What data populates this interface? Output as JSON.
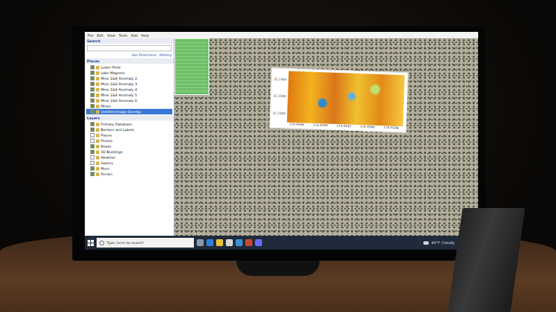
{
  "window": {
    "menu": [
      "File",
      "Edit",
      "View",
      "Tools",
      "Add",
      "Help"
    ]
  },
  "search": {
    "title": "Search",
    "links": [
      "Get Directions",
      "History"
    ]
  },
  "places": {
    "title": "Places",
    "items": [
      {
        "label": "Lower Field",
        "checked": true,
        "selected": false
      },
      {
        "label": "Lake Magnets",
        "checked": true,
        "selected": false
      },
      {
        "label": "Mine 1&4 Anomaly 2",
        "checked": true,
        "selected": false
      },
      {
        "label": "Mine 1&4 Anomaly 3",
        "checked": true,
        "selected": false
      },
      {
        "label": "Mine 1&4 Anomaly 4",
        "checked": true,
        "selected": false
      },
      {
        "label": "Mine 1&4 Anomaly 5",
        "checked": true,
        "selected": false
      },
      {
        "label": "Mine 1&4 Anomaly 6",
        "checked": true,
        "selected": false
      },
      {
        "label": "Mines",
        "checked": true,
        "selected": false
      },
      {
        "label": "Untitled Image Overlay",
        "checked": true,
        "selected": true
      }
    ]
  },
  "layers": {
    "title": "Layers",
    "items": [
      {
        "label": "Primary Database",
        "checked": true
      },
      {
        "label": "Borders and Labels",
        "checked": true
      },
      {
        "label": "Places",
        "checked": false
      },
      {
        "label": "Photos",
        "checked": false
      },
      {
        "label": "Roads",
        "checked": true
      },
      {
        "label": "3D Buildings",
        "checked": true
      },
      {
        "label": "Weather",
        "checked": false
      },
      {
        "label": "Gallery",
        "checked": false
      },
      {
        "label": "More",
        "checked": true
      },
      {
        "label": "Terrain",
        "checked": true
      }
    ]
  },
  "overlay": {
    "y_ticks": [
      "32.2345",
      "32.2340",
      "32.2335"
    ],
    "x_ticks": [
      "114.4346",
      "114.4344",
      "114.4342",
      "114.4340",
      "114.4338"
    ]
  },
  "taskbar": {
    "search_placeholder": "Type here to search",
    "weather": "40°F Cloudy"
  }
}
